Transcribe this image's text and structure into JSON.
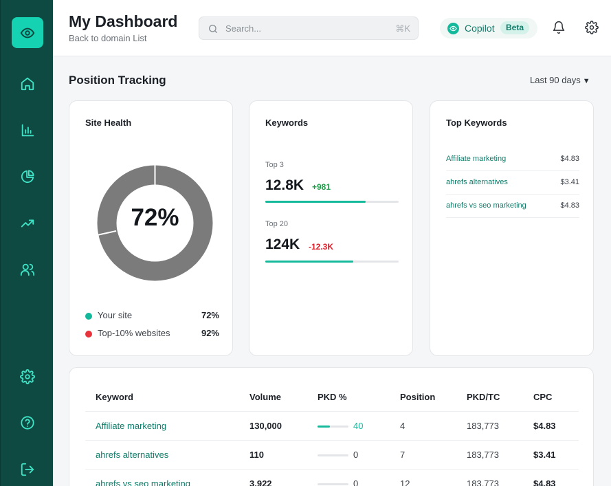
{
  "header": {
    "title": "My Dashboard",
    "subtitle": "Back to domain List",
    "search_placeholder": "Search...",
    "search_shortcut": "⌘K",
    "copilot_label": "Copilot",
    "copilot_badge": "Beta"
  },
  "sidebar": {
    "items": [
      {
        "name": "home-icon"
      },
      {
        "name": "bar-chart-icon"
      },
      {
        "name": "pie-chart-icon"
      },
      {
        "name": "trending-up-icon"
      },
      {
        "name": "users-icon"
      },
      {
        "name": "settings-icon"
      },
      {
        "name": "help-icon"
      },
      {
        "name": "logout-icon"
      }
    ]
  },
  "section": {
    "title": "Position Tracking",
    "range": "Last 90 days"
  },
  "site_health": {
    "title": "Site Health",
    "percent_label": "72%",
    "legend": [
      {
        "label": "Your site",
        "value": "72%",
        "color": "#13b89b"
      },
      {
        "label": "Top-10% websites",
        "value": "92%",
        "color": "#e8333c"
      }
    ]
  },
  "keywords": {
    "title": "Keywords",
    "groups": [
      {
        "label": "Top 3",
        "value": "12.8K",
        "delta": "+981",
        "delta_color": "#1f9e4a",
        "progress": 0.75
      },
      {
        "label": "Top 20",
        "value": "124K",
        "delta": "-12.3K",
        "delta_color": "#d9202b",
        "progress": 0.66
      }
    ]
  },
  "top_keywords": {
    "title": "Top Keywords",
    "rows": [
      {
        "name": "Affiliate marketing",
        "value": "$4.83"
      },
      {
        "name": "ahrefs alternatives",
        "value": "$3.41"
      },
      {
        "name": "ahrefs vs seo marketing",
        "value": "$4.83"
      }
    ]
  },
  "table": {
    "headers": {
      "keyword": "Keyword",
      "volume": "Volume",
      "pkd": "PKD %",
      "position": "Position",
      "pkdtc": "PKD/TC",
      "cpc": "CPC"
    },
    "rows": [
      {
        "keyword": "Affiliate marketing",
        "volume": "130,000",
        "pkd": "40",
        "pkd_level": 0.4,
        "position": "4",
        "pkdtc": "183,773",
        "cpc": "$4.83"
      },
      {
        "keyword": "ahrefs alternatives",
        "volume": "110",
        "pkd": "0",
        "pkd_level": 0,
        "position": "7",
        "pkdtc": "183,773",
        "cpc": "$3.41"
      },
      {
        "keyword": "ahrefs vs seo marketing",
        "volume": "3,922",
        "pkd": "0",
        "pkd_level": 0,
        "position": "12",
        "pkdtc": "183,773",
        "cpc": "$4.83"
      }
    ]
  },
  "colors": {
    "sidebar": "#0e4a42",
    "accent": "#15d2b2",
    "donut_gray": "#7b7b7b"
  }
}
